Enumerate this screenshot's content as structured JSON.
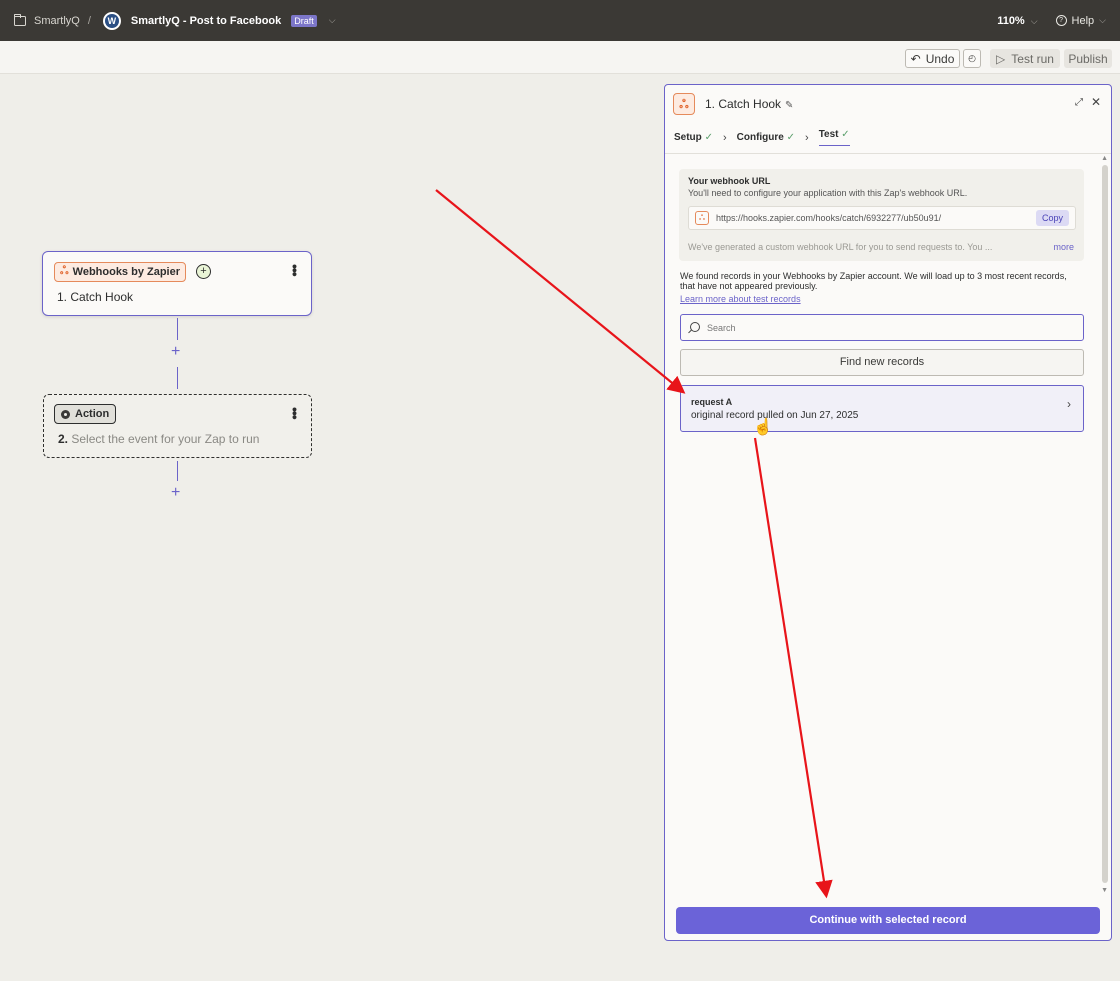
{
  "topbar": {
    "folder": "SmartlyQ",
    "separator": "/",
    "zap_logo_letter": "W",
    "zap_title": "SmartlyQ - Post to Facebook",
    "status_badge": "Draft",
    "zoom": "110%",
    "help": "Help",
    "chevron": "⌵"
  },
  "toolbar": {
    "undo": "Undo",
    "test_run": "Test run",
    "publish": "Publish"
  },
  "canvas": {
    "trigger": {
      "app": "Webhooks by Zapier",
      "title": "1. Catch Hook"
    },
    "action": {
      "pill": "Action",
      "step_number": "2.",
      "text": "Select the event for your Zap to run"
    },
    "plus": "+"
  },
  "panel": {
    "title": "1. Catch Hook",
    "steps": [
      {
        "label": "Setup"
      },
      {
        "label": "Configure"
      },
      {
        "label": "Test"
      }
    ],
    "webhook": {
      "label": "Your webhook URL",
      "description": "You'll need to configure your application with this Zap's webhook URL.",
      "url": "https://hooks.zapier.com/hooks/catch/6932277/ub50u91/",
      "copy": "Copy",
      "note": "We've generated a custom webhook URL for you to send requests to. You ...",
      "more": "more"
    },
    "found_text": "We found records in your Webhooks by Zapier account. We will load up to 3 most recent records, that have not appeared previously.",
    "learn_more": "Learn more about test records",
    "search_placeholder": "Search",
    "find_button": "Find new records",
    "records": [
      {
        "title": "request A",
        "subtitle": "original record pulled on Jun 27, 2025"
      }
    ],
    "continue": "Continue with selected record"
  },
  "colors": {
    "accent": "#6b63c9",
    "annotation_arrow": "#e8141a",
    "webhook_orange": "#e0622a"
  }
}
